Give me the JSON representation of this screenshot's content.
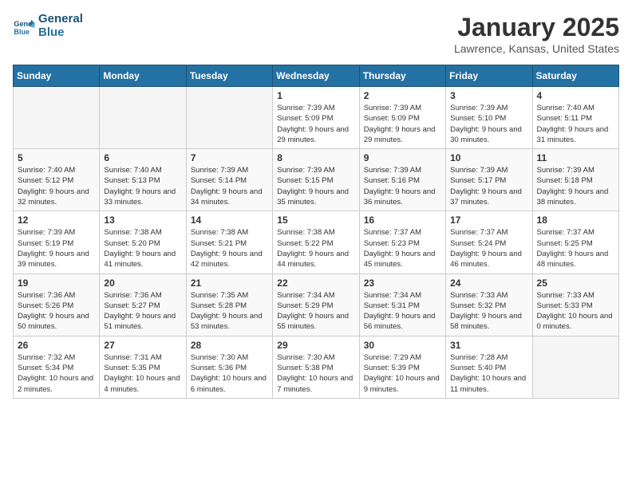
{
  "logo": {
    "line1": "General",
    "line2": "Blue"
  },
  "title": "January 2025",
  "location": "Lawrence, Kansas, United States",
  "weekdays": [
    "Sunday",
    "Monday",
    "Tuesday",
    "Wednesday",
    "Thursday",
    "Friday",
    "Saturday"
  ],
  "weeks": [
    [
      {
        "day": "",
        "empty": true
      },
      {
        "day": "",
        "empty": true
      },
      {
        "day": "",
        "empty": true
      },
      {
        "day": "1",
        "sunrise": "7:39 AM",
        "sunset": "5:09 PM",
        "daylight": "9 hours and 29 minutes."
      },
      {
        "day": "2",
        "sunrise": "7:39 AM",
        "sunset": "5:09 PM",
        "daylight": "9 hours and 29 minutes."
      },
      {
        "day": "3",
        "sunrise": "7:39 AM",
        "sunset": "5:10 PM",
        "daylight": "9 hours and 30 minutes."
      },
      {
        "day": "4",
        "sunrise": "7:40 AM",
        "sunset": "5:11 PM",
        "daylight": "9 hours and 31 minutes."
      }
    ],
    [
      {
        "day": "5",
        "sunrise": "7:40 AM",
        "sunset": "5:12 PM",
        "daylight": "9 hours and 32 minutes."
      },
      {
        "day": "6",
        "sunrise": "7:40 AM",
        "sunset": "5:13 PM",
        "daylight": "9 hours and 33 minutes."
      },
      {
        "day": "7",
        "sunrise": "7:39 AM",
        "sunset": "5:14 PM",
        "daylight": "9 hours and 34 minutes."
      },
      {
        "day": "8",
        "sunrise": "7:39 AM",
        "sunset": "5:15 PM",
        "daylight": "9 hours and 35 minutes."
      },
      {
        "day": "9",
        "sunrise": "7:39 AM",
        "sunset": "5:16 PM",
        "daylight": "9 hours and 36 minutes."
      },
      {
        "day": "10",
        "sunrise": "7:39 AM",
        "sunset": "5:17 PM",
        "daylight": "9 hours and 37 minutes."
      },
      {
        "day": "11",
        "sunrise": "7:39 AM",
        "sunset": "5:18 PM",
        "daylight": "9 hours and 38 minutes."
      }
    ],
    [
      {
        "day": "12",
        "sunrise": "7:39 AM",
        "sunset": "5:19 PM",
        "daylight": "9 hours and 39 minutes."
      },
      {
        "day": "13",
        "sunrise": "7:38 AM",
        "sunset": "5:20 PM",
        "daylight": "9 hours and 41 minutes."
      },
      {
        "day": "14",
        "sunrise": "7:38 AM",
        "sunset": "5:21 PM",
        "daylight": "9 hours and 42 minutes."
      },
      {
        "day": "15",
        "sunrise": "7:38 AM",
        "sunset": "5:22 PM",
        "daylight": "9 hours and 44 minutes."
      },
      {
        "day": "16",
        "sunrise": "7:37 AM",
        "sunset": "5:23 PM",
        "daylight": "9 hours and 45 minutes."
      },
      {
        "day": "17",
        "sunrise": "7:37 AM",
        "sunset": "5:24 PM",
        "daylight": "9 hours and 46 minutes."
      },
      {
        "day": "18",
        "sunrise": "7:37 AM",
        "sunset": "5:25 PM",
        "daylight": "9 hours and 48 minutes."
      }
    ],
    [
      {
        "day": "19",
        "sunrise": "7:36 AM",
        "sunset": "5:26 PM",
        "daylight": "9 hours and 50 minutes."
      },
      {
        "day": "20",
        "sunrise": "7:36 AM",
        "sunset": "5:27 PM",
        "daylight": "9 hours and 51 minutes."
      },
      {
        "day": "21",
        "sunrise": "7:35 AM",
        "sunset": "5:28 PM",
        "daylight": "9 hours and 53 minutes."
      },
      {
        "day": "22",
        "sunrise": "7:34 AM",
        "sunset": "5:29 PM",
        "daylight": "9 hours and 55 minutes."
      },
      {
        "day": "23",
        "sunrise": "7:34 AM",
        "sunset": "5:31 PM",
        "daylight": "9 hours and 56 minutes."
      },
      {
        "day": "24",
        "sunrise": "7:33 AM",
        "sunset": "5:32 PM",
        "daylight": "9 hours and 58 minutes."
      },
      {
        "day": "25",
        "sunrise": "7:33 AM",
        "sunset": "5:33 PM",
        "daylight": "10 hours and 0 minutes."
      }
    ],
    [
      {
        "day": "26",
        "sunrise": "7:32 AM",
        "sunset": "5:34 PM",
        "daylight": "10 hours and 2 minutes."
      },
      {
        "day": "27",
        "sunrise": "7:31 AM",
        "sunset": "5:35 PM",
        "daylight": "10 hours and 4 minutes."
      },
      {
        "day": "28",
        "sunrise": "7:30 AM",
        "sunset": "5:36 PM",
        "daylight": "10 hours and 6 minutes."
      },
      {
        "day": "29",
        "sunrise": "7:30 AM",
        "sunset": "5:38 PM",
        "daylight": "10 hours and 7 minutes."
      },
      {
        "day": "30",
        "sunrise": "7:29 AM",
        "sunset": "5:39 PM",
        "daylight": "10 hours and 9 minutes."
      },
      {
        "day": "31",
        "sunrise": "7:28 AM",
        "sunset": "5:40 PM",
        "daylight": "10 hours and 11 minutes."
      },
      {
        "day": "",
        "empty": true
      }
    ]
  ],
  "labels": {
    "sunrise": "Sunrise:",
    "sunset": "Sunset:",
    "daylight": "Daylight hours"
  }
}
